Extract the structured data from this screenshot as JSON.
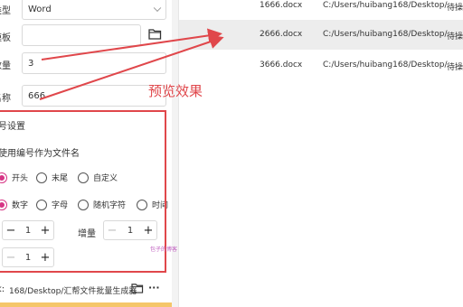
{
  "form": {
    "type_label": "类型",
    "type_value": "Word",
    "template_label": "模板",
    "template_value": "",
    "count_label": "数量",
    "count_value": "3",
    "name_label": "名称",
    "name_value": "666"
  },
  "numbering": {
    "title": "号设置",
    "use_numbering": "使用编号作为文件名",
    "position_options": [
      {
        "label": "开头",
        "checked": true
      },
      {
        "label": "末尾",
        "checked": false
      },
      {
        "label": "自定义",
        "checked": false
      }
    ],
    "kind_options": [
      {
        "label": "数字",
        "checked": true
      },
      {
        "label": "字母",
        "checked": false
      },
      {
        "label": "随机字符",
        "checked": false
      },
      {
        "label": "时间",
        "checked": false
      }
    ],
    "start_value": "1",
    "increment_label": "增量",
    "increment_value": "1",
    "digits_value": "1"
  },
  "output": {
    "path_label": "k:",
    "path_value": "168/Desktop/汇帮文件批量生成器"
  },
  "annotation": {
    "preview_label": "预览效果",
    "watermark": "包子的博客"
  },
  "files": {
    "rows": [
      {
        "name": "1666.docx",
        "path": "C:/Users/huibang168/Desktop/",
        "status": "待操作",
        "selected": false
      },
      {
        "name": "2666.docx",
        "path": "C:/Users/huibang168/Desktop/",
        "status": "待操作",
        "selected": true
      },
      {
        "name": "3666.docx",
        "path": "C:/Users/huibang168/Desktop/",
        "status": "待操作",
        "selected": false
      }
    ]
  },
  "colors": {
    "accent": "#d63384",
    "annotation": "#e0474b"
  },
  "icons": {
    "folder": "folder-icon",
    "more": "more-icon",
    "chevron": "chevron-down-icon"
  }
}
